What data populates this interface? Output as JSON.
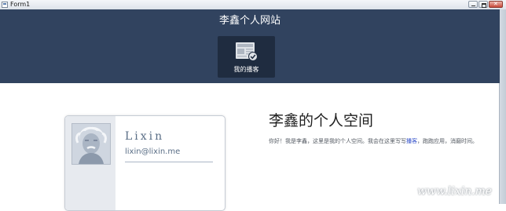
{
  "window": {
    "title": "Form1"
  },
  "header": {
    "site_title": "李鑫个人网站",
    "tile": {
      "icon": "newspaper-check-icon",
      "label": "我的播客"
    }
  },
  "card": {
    "name": "Lixin",
    "email": "lixin@lixin.me",
    "avatar": "einstein-avatar"
  },
  "main": {
    "headline": "李鑫的个人空间",
    "intro_before": "你好！我是李鑫，这里是我的个人空间。我会在这里写写",
    "intro_link": "播客",
    "intro_after": "，跑跑应用，消磨时间。"
  },
  "watermark": "www.lixin.me",
  "colors": {
    "header_bg": "#31435f",
    "tile_bg": "#1f2c40",
    "link": "#2a49c7"
  }
}
